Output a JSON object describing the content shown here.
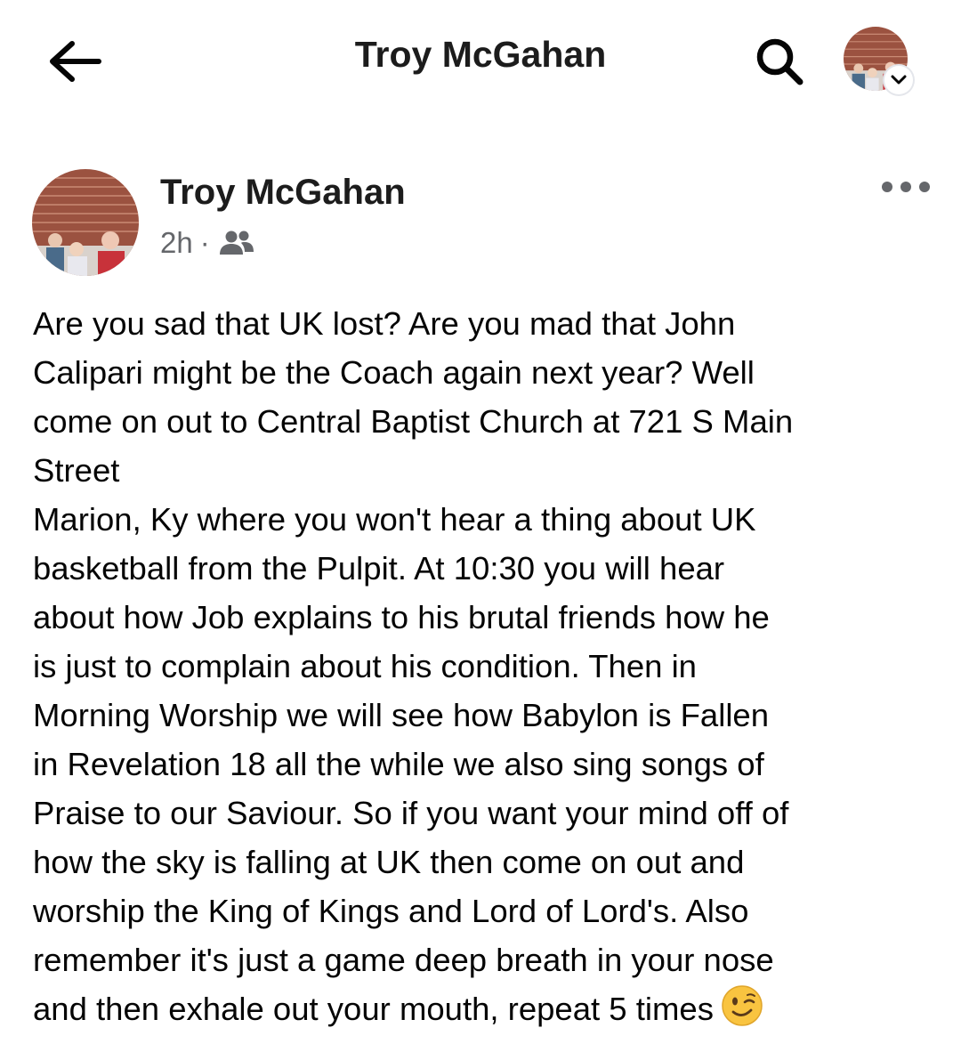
{
  "header": {
    "title": "Troy McGahan",
    "back_icon": "arrow-left-icon",
    "search_icon": "search-icon",
    "account_icon": "chevron-down-icon"
  },
  "post": {
    "author": "Troy McGahan",
    "time": "2h",
    "separator": "·",
    "audience_icon": "friends-icon",
    "more_icon": "more-horizontal-icon",
    "lines": [
      "Are you sad that UK lost? Are you mad that John",
      "Calipari  might be the Coach again next year? Well",
      "come on out to Central Baptist Church at 721 S Main",
      "Street",
      "Marion, Ky where you won't hear a thing about UK",
      "basketball from the Pulpit. At 10:30 you will hear",
      "about how Job explains to his brutal friends how he",
      "is just to complain about his condition.  Then in",
      "Morning Worship we will see how Babylon is Fallen",
      "in Revelation 18 all the while we also sing songs of",
      "Praise to our Saviour. So if you want your mind off of",
      "how the sky is falling at UK then come on out and",
      "worship the King of Kings and Lord of Lord's. Also",
      "remember it's just a game deep breath in your nose",
      "and then exhale out your mouth, repeat 5 times"
    ],
    "emoji": "winking-face-emoji"
  },
  "colors": {
    "text": "#050505",
    "secondary_text": "#65676b",
    "background": "#ffffff",
    "emoji_yellow": "#f9c440"
  }
}
